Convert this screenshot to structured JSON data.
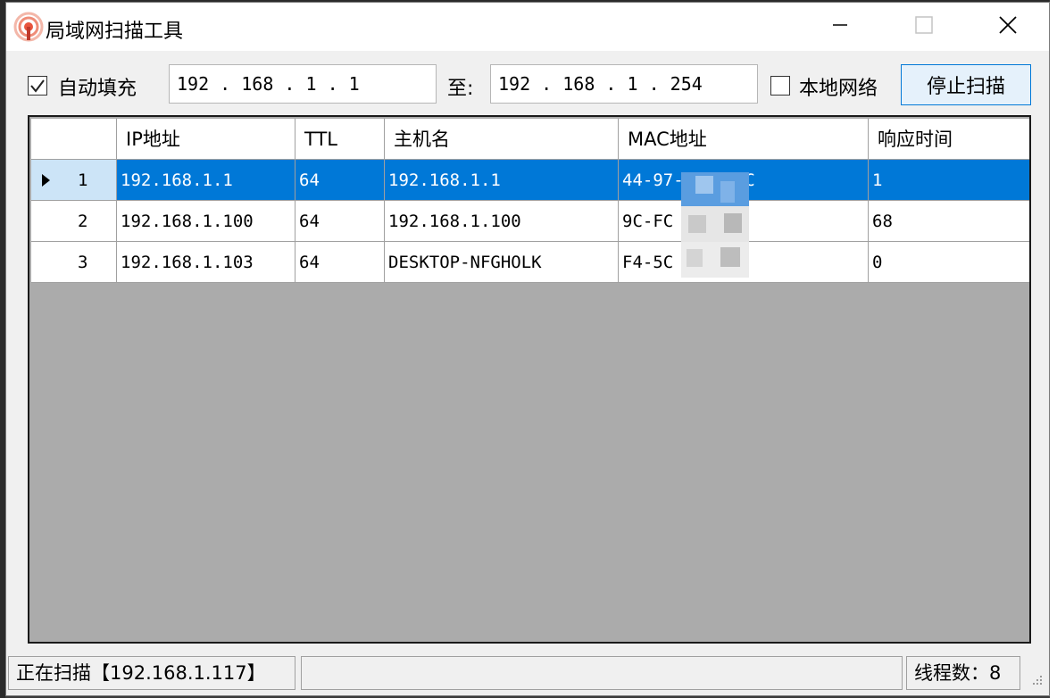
{
  "window": {
    "title": "局域网扫描工具",
    "app_icon": "wifi-antenna-icon"
  },
  "toolbar": {
    "auto_fill_checked": true,
    "auto_fill_label": "自动填充",
    "start_ip": "192 . 168 . 1 . 1",
    "to_label": "至:",
    "end_ip": "192 . 168 . 1 . 254",
    "local_network_checked": false,
    "local_network_label": "本地网络",
    "stop_button_label": "停止扫描"
  },
  "grid": {
    "columns": [
      "IP地址",
      "TTL",
      "主机名",
      "MAC地址",
      "响应时间"
    ],
    "rows": [
      {
        "index": "1",
        "ip": "192.168.1.1",
        "ttl": "64",
        "host": "192.168.1.1",
        "mac": "44-97-  -A7-AC",
        "rt": "1",
        "selected": true
      },
      {
        "index": "2",
        "ip": "192.168.1.100",
        "ttl": "64",
        "host": "192.168.1.100",
        "mac": "9C-FC  90-6D",
        "rt": "68",
        "selected": false
      },
      {
        "index": "3",
        "ip": "192.168.1.103",
        "ttl": "64",
        "host": "DESKTOP-NFGHOLK",
        "mac": "F4-5C  7A-07",
        "rt": "0",
        "selected": false
      }
    ]
  },
  "status": {
    "scanning": "正在扫描【192.168.1.117】",
    "middle": "",
    "threads": "线程数：8"
  },
  "colors": {
    "selection": "#0078d7",
    "grid_background": "#ababab",
    "button_hover": "#e5f1fb"
  }
}
